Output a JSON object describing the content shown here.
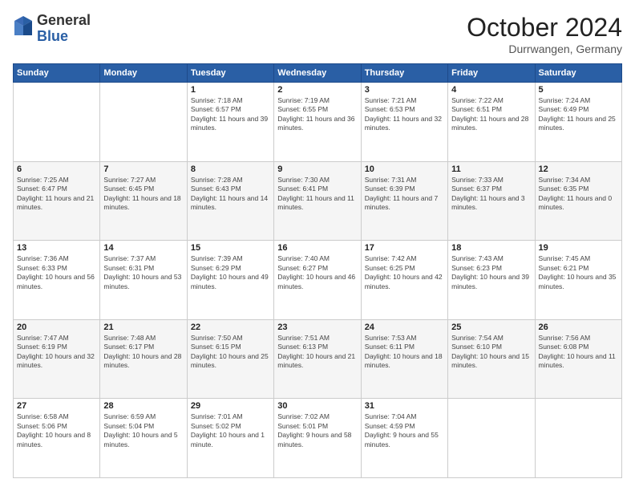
{
  "header": {
    "logo_general": "General",
    "logo_blue": "Blue",
    "month_title": "October 2024",
    "location": "Durrwangen, Germany"
  },
  "weekdays": [
    "Sunday",
    "Monday",
    "Tuesday",
    "Wednesday",
    "Thursday",
    "Friday",
    "Saturday"
  ],
  "weeks": [
    [
      {
        "day": "",
        "sunrise": "",
        "sunset": "",
        "daylight": ""
      },
      {
        "day": "",
        "sunrise": "",
        "sunset": "",
        "daylight": ""
      },
      {
        "day": "1",
        "sunrise": "Sunrise: 7:18 AM",
        "sunset": "Sunset: 6:57 PM",
        "daylight": "Daylight: 11 hours and 39 minutes."
      },
      {
        "day": "2",
        "sunrise": "Sunrise: 7:19 AM",
        "sunset": "Sunset: 6:55 PM",
        "daylight": "Daylight: 11 hours and 36 minutes."
      },
      {
        "day": "3",
        "sunrise": "Sunrise: 7:21 AM",
        "sunset": "Sunset: 6:53 PM",
        "daylight": "Daylight: 11 hours and 32 minutes."
      },
      {
        "day": "4",
        "sunrise": "Sunrise: 7:22 AM",
        "sunset": "Sunset: 6:51 PM",
        "daylight": "Daylight: 11 hours and 28 minutes."
      },
      {
        "day": "5",
        "sunrise": "Sunrise: 7:24 AM",
        "sunset": "Sunset: 6:49 PM",
        "daylight": "Daylight: 11 hours and 25 minutes."
      }
    ],
    [
      {
        "day": "6",
        "sunrise": "Sunrise: 7:25 AM",
        "sunset": "Sunset: 6:47 PM",
        "daylight": "Daylight: 11 hours and 21 minutes."
      },
      {
        "day": "7",
        "sunrise": "Sunrise: 7:27 AM",
        "sunset": "Sunset: 6:45 PM",
        "daylight": "Daylight: 11 hours and 18 minutes."
      },
      {
        "day": "8",
        "sunrise": "Sunrise: 7:28 AM",
        "sunset": "Sunset: 6:43 PM",
        "daylight": "Daylight: 11 hours and 14 minutes."
      },
      {
        "day": "9",
        "sunrise": "Sunrise: 7:30 AM",
        "sunset": "Sunset: 6:41 PM",
        "daylight": "Daylight: 11 hours and 11 minutes."
      },
      {
        "day": "10",
        "sunrise": "Sunrise: 7:31 AM",
        "sunset": "Sunset: 6:39 PM",
        "daylight": "Daylight: 11 hours and 7 minutes."
      },
      {
        "day": "11",
        "sunrise": "Sunrise: 7:33 AM",
        "sunset": "Sunset: 6:37 PM",
        "daylight": "Daylight: 11 hours and 3 minutes."
      },
      {
        "day": "12",
        "sunrise": "Sunrise: 7:34 AM",
        "sunset": "Sunset: 6:35 PM",
        "daylight": "Daylight: 11 hours and 0 minutes."
      }
    ],
    [
      {
        "day": "13",
        "sunrise": "Sunrise: 7:36 AM",
        "sunset": "Sunset: 6:33 PM",
        "daylight": "Daylight: 10 hours and 56 minutes."
      },
      {
        "day": "14",
        "sunrise": "Sunrise: 7:37 AM",
        "sunset": "Sunset: 6:31 PM",
        "daylight": "Daylight: 10 hours and 53 minutes."
      },
      {
        "day": "15",
        "sunrise": "Sunrise: 7:39 AM",
        "sunset": "Sunset: 6:29 PM",
        "daylight": "Daylight: 10 hours and 49 minutes."
      },
      {
        "day": "16",
        "sunrise": "Sunrise: 7:40 AM",
        "sunset": "Sunset: 6:27 PM",
        "daylight": "Daylight: 10 hours and 46 minutes."
      },
      {
        "day": "17",
        "sunrise": "Sunrise: 7:42 AM",
        "sunset": "Sunset: 6:25 PM",
        "daylight": "Daylight: 10 hours and 42 minutes."
      },
      {
        "day": "18",
        "sunrise": "Sunrise: 7:43 AM",
        "sunset": "Sunset: 6:23 PM",
        "daylight": "Daylight: 10 hours and 39 minutes."
      },
      {
        "day": "19",
        "sunrise": "Sunrise: 7:45 AM",
        "sunset": "Sunset: 6:21 PM",
        "daylight": "Daylight: 10 hours and 35 minutes."
      }
    ],
    [
      {
        "day": "20",
        "sunrise": "Sunrise: 7:47 AM",
        "sunset": "Sunset: 6:19 PM",
        "daylight": "Daylight: 10 hours and 32 minutes."
      },
      {
        "day": "21",
        "sunrise": "Sunrise: 7:48 AM",
        "sunset": "Sunset: 6:17 PM",
        "daylight": "Daylight: 10 hours and 28 minutes."
      },
      {
        "day": "22",
        "sunrise": "Sunrise: 7:50 AM",
        "sunset": "Sunset: 6:15 PM",
        "daylight": "Daylight: 10 hours and 25 minutes."
      },
      {
        "day": "23",
        "sunrise": "Sunrise: 7:51 AM",
        "sunset": "Sunset: 6:13 PM",
        "daylight": "Daylight: 10 hours and 21 minutes."
      },
      {
        "day": "24",
        "sunrise": "Sunrise: 7:53 AM",
        "sunset": "Sunset: 6:11 PM",
        "daylight": "Daylight: 10 hours and 18 minutes."
      },
      {
        "day": "25",
        "sunrise": "Sunrise: 7:54 AM",
        "sunset": "Sunset: 6:10 PM",
        "daylight": "Daylight: 10 hours and 15 minutes."
      },
      {
        "day": "26",
        "sunrise": "Sunrise: 7:56 AM",
        "sunset": "Sunset: 6:08 PM",
        "daylight": "Daylight: 10 hours and 11 minutes."
      }
    ],
    [
      {
        "day": "27",
        "sunrise": "Sunrise: 6:58 AM",
        "sunset": "Sunset: 5:06 PM",
        "daylight": "Daylight: 10 hours and 8 minutes."
      },
      {
        "day": "28",
        "sunrise": "Sunrise: 6:59 AM",
        "sunset": "Sunset: 5:04 PM",
        "daylight": "Daylight: 10 hours and 5 minutes."
      },
      {
        "day": "29",
        "sunrise": "Sunrise: 7:01 AM",
        "sunset": "Sunset: 5:02 PM",
        "daylight": "Daylight: 10 hours and 1 minute."
      },
      {
        "day": "30",
        "sunrise": "Sunrise: 7:02 AM",
        "sunset": "Sunset: 5:01 PM",
        "daylight": "Daylight: 9 hours and 58 minutes."
      },
      {
        "day": "31",
        "sunrise": "Sunrise: 7:04 AM",
        "sunset": "Sunset: 4:59 PM",
        "daylight": "Daylight: 9 hours and 55 minutes."
      },
      {
        "day": "",
        "sunrise": "",
        "sunset": "",
        "daylight": ""
      },
      {
        "day": "",
        "sunrise": "",
        "sunset": "",
        "daylight": ""
      }
    ]
  ]
}
